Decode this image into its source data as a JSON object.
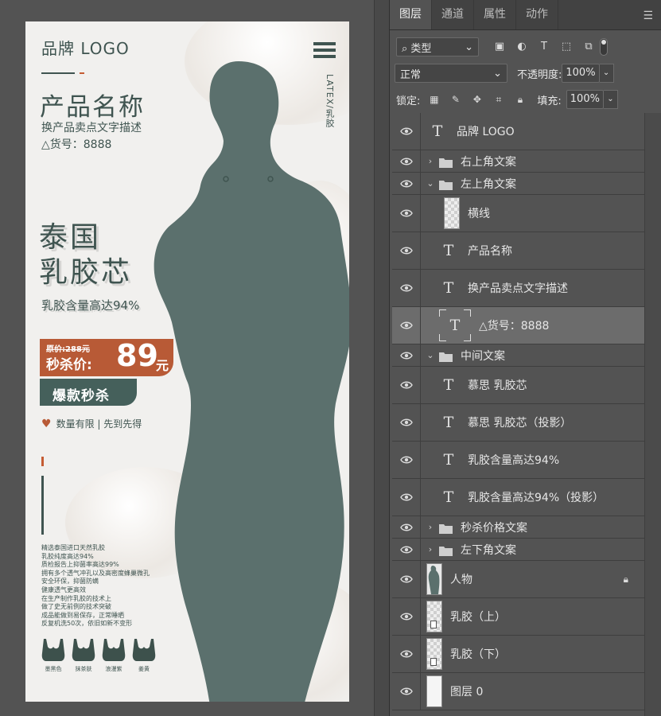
{
  "poster": {
    "logo": "品牌 LOGO",
    "latex_vertical": "LATEX/乳胶",
    "product_name": "产品名称",
    "product_desc": "换产品卖点文字描述",
    "sku": "△货号：8888",
    "headline_line1": "泰国",
    "headline_line2": "乳胶芯",
    "latex_content": "乳胶含量高达94%",
    "original_price": "原价:288元",
    "sale_label": "秒杀价:",
    "sale_price": "89",
    "sale_unit": "元",
    "hot_sale": "爆款秒杀",
    "limited": "数量有限 | 先到先得",
    "features": [
      "精选泰国进口天然乳胶",
      "乳胶纯度高达94%",
      "质检报告上抑菌率高达99%",
      "拥有多个透气冲孔以及高密度蜂巢微孔",
      "安全环保，抑菌防螨",
      "健康透气更高效",
      "在生产制作乳胶的技术上",
      "做了史无前例的技术突破",
      "成品能做到易保存，正常睡晒",
      "反复机洗50次，依旧如新不变形"
    ],
    "colors": [
      {
        "name": "墨黑色",
        "color": "#3d514c"
      },
      {
        "name": "抹茶肤",
        "color": "#3d514c"
      },
      {
        "name": "浪漫紫",
        "color": "#3d514c"
      },
      {
        "name": "姜黄",
        "color": "#3d514c"
      }
    ],
    "accent_dark": "#3f5450",
    "accent_red": "#b85a36"
  },
  "panel": {
    "tabs": [
      {
        "label": "图层",
        "active": true
      },
      {
        "label": "通道",
        "active": false
      },
      {
        "label": "属性",
        "active": false
      },
      {
        "label": "动作",
        "active": false
      }
    ],
    "filter_label": "类型",
    "blend_mode": "正常",
    "opacity_label": "不透明度:",
    "opacity_value": "100%",
    "lock_label": "锁定:",
    "fill_label": "填充:",
    "fill_value": "100%",
    "layers": [
      {
        "type": "text",
        "name": "品牌 LOGO",
        "indent": 0
      },
      {
        "type": "group",
        "name": "右上角文案",
        "expanded": false
      },
      {
        "type": "group",
        "name": "左上角文案",
        "expanded": true
      },
      {
        "type": "pixel",
        "name": "横线",
        "indent": 1
      },
      {
        "type": "text",
        "name": "产品名称",
        "indent": 1
      },
      {
        "type": "text",
        "name": "换产品卖点文字描述",
        "indent": 1
      },
      {
        "type": "text",
        "name": "△货号：8888",
        "indent": 1,
        "selected": true
      },
      {
        "type": "group",
        "name": "中间文案",
        "expanded": true
      },
      {
        "type": "text",
        "name": "慕思 乳胶芯",
        "indent": 1
      },
      {
        "type": "text",
        "name": "慕思 乳胶芯（投影）",
        "indent": 1
      },
      {
        "type": "text",
        "name": "乳胶含量高达94%",
        "indent": 1
      },
      {
        "type": "text",
        "name": "乳胶含量高达94%（投影）",
        "indent": 1
      },
      {
        "type": "group",
        "name": "秒杀价格文案",
        "expanded": false
      },
      {
        "type": "group",
        "name": "左下角文案",
        "expanded": false
      },
      {
        "type": "person",
        "name": "人物",
        "locked": true
      },
      {
        "type": "milk",
        "name": "乳胶（上）"
      },
      {
        "type": "milk",
        "name": "乳胶（下）"
      },
      {
        "type": "white",
        "name": "图层 0"
      }
    ]
  }
}
